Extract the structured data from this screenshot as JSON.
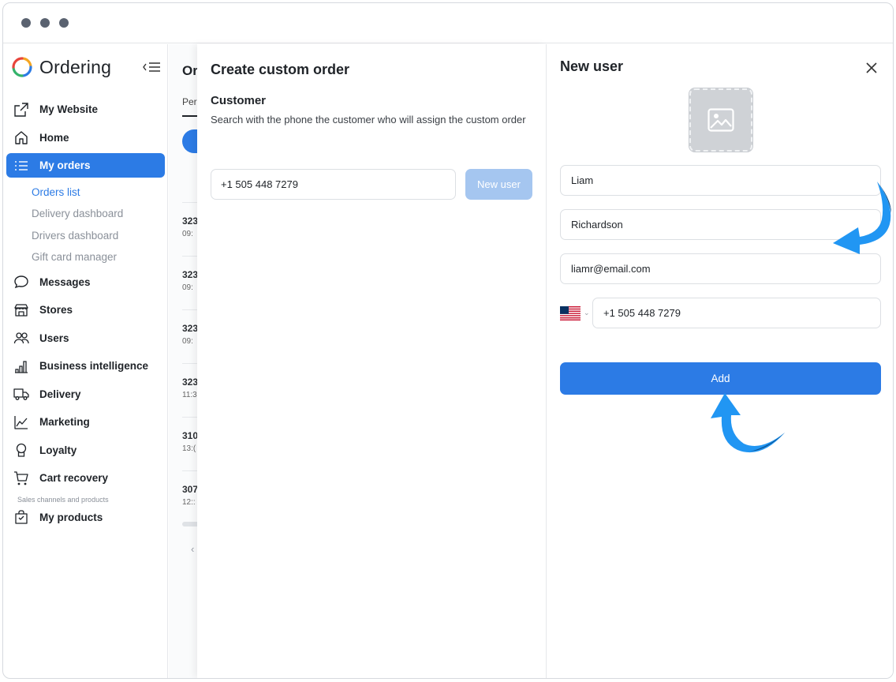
{
  "app": {
    "name": "Ordering"
  },
  "sidebar": {
    "items": [
      {
        "label": "My Website",
        "icon": "external-link-icon"
      },
      {
        "label": "Home",
        "icon": "home-icon"
      },
      {
        "label": "My orders",
        "icon": "list-icon",
        "active": true
      }
    ],
    "sub_items": [
      {
        "label": "Orders list",
        "active": true
      },
      {
        "label": "Delivery dashboard"
      },
      {
        "label": "Drivers dashboard"
      },
      {
        "label": "Gift card manager"
      }
    ],
    "items2": [
      {
        "label": "Messages",
        "icon": "chat-bubble-icon"
      },
      {
        "label": "Stores",
        "icon": "storefront-icon"
      },
      {
        "label": "Users",
        "icon": "users-icon"
      },
      {
        "label": "Business intelligence",
        "icon": "bar-chart-icon"
      },
      {
        "label": "Delivery",
        "icon": "truck-icon"
      },
      {
        "label": "Marketing",
        "icon": "trend-line-icon"
      },
      {
        "label": "Loyalty",
        "icon": "award-icon"
      },
      {
        "label": "Cart recovery",
        "icon": "cart-icon"
      }
    ],
    "section_label": "Sales channels and products",
    "items3": [
      {
        "label": "My products",
        "icon": "shopping-bag-icon"
      }
    ]
  },
  "orders": {
    "title": "Or",
    "tab": "Per",
    "rows": [
      {
        "id": "323",
        "time": "09:"
      },
      {
        "id": "323",
        "time": "09:"
      },
      {
        "id": "323",
        "time": "09:"
      },
      {
        "id": "323",
        "time": "11:3"
      },
      {
        "id": "310",
        "time": "13:("
      },
      {
        "id": "307",
        "time": "12::"
      }
    ]
  },
  "create_order": {
    "title": "Create custom order",
    "section": "Customer",
    "description": "Search with the phone the customer who will assign the custom order",
    "phone_value": "+1 505 448 7279",
    "new_user_label": "New user"
  },
  "new_user": {
    "title": "New user",
    "first_name": "Liam",
    "last_name": "Richardson",
    "email": "liamr@email.com",
    "phone": "+1 505 448 7279",
    "country_icon": "us-flag-icon",
    "add_label": "Add"
  },
  "colors": {
    "accent": "#2c7be5",
    "disabled_button": "#a5c6f0",
    "annotation_arrow": "#2196f3"
  }
}
